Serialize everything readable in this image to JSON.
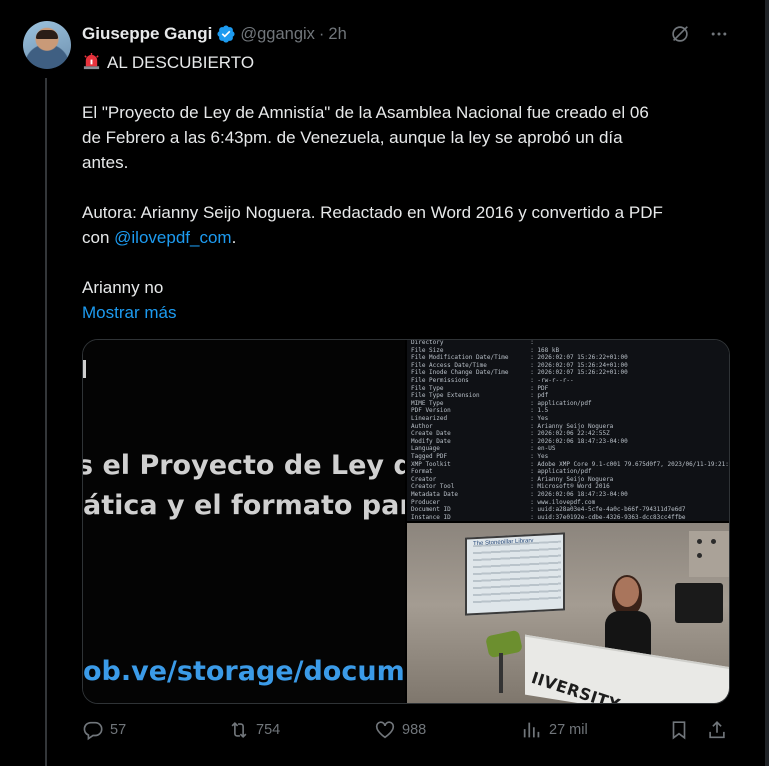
{
  "author": {
    "name": "Giuseppe Gangi",
    "handle": "@ggangix",
    "separator": "·",
    "time": "2h"
  },
  "post": {
    "emoji_icon": "police-siren-icon",
    "heading": "AL DESCUBIERTO",
    "line1": "El \"Proyecto de Ley de Amnistía\" de la Asamblea Nacional fue creado el 06",
    "line2": "de Febrero a las 6:43pm. de Venezuela, aunque la ley se aprobó un día",
    "line3": "antes.",
    "line4": "Autora: Arianny Seijo Noguera. Redactado en Word 2016 y convertido a PDF",
    "line5_prefix": "con ",
    "line5_link": "@ilovepdf_com",
    "line5_suffix": ".",
    "line6": "Arianny no",
    "show_more": "Mostrar más"
  },
  "media": {
    "left_doc": {
      "line1": "s el Proyecto de Ley de A",
      "line2": "ática y el formato para r",
      "url": "ob.ve/storage/docume..."
    },
    "terminal": [
      "Directory                        : ",
      "File Size                        : 168 kB",
      "File Modification Date/Time      : 2026:02:07 15:26:22+01:00",
      "File Access Date/Time            : 2026:02:07 15:26:24+01:00",
      "File Inode Change Date/Time      : 2026:02:07 15:26:22+01:00",
      "File Permissions                 : -rw-r--r--",
      "File Type                        : PDF",
      "File Type Extension              : pdf",
      "MIME Type                        : application/pdf",
      "PDF Version                      : 1.5",
      "Linearized                       : Yes",
      "Author                           : Arianny Seijo Noguera",
      "Create Date                      : 2026:02:06 22:42:55Z",
      "Modify Date                      : 2026:02:06 18:47:23-04:00",
      "Language                         : en-US",
      "Tagged PDF                       : Yes",
      "XMP Toolkit                      : Adobe XMP Core 9.1-c001 79.675d0f7, 2023/06/11-19:21:16",
      "Format                           : application/pdf",
      "Creator                          : Arianny Seijo Noguera",
      "Creator Tool                     : Microsoft® Word 2016",
      "Metadata Date                    : 2026:02:06 18:47:23-04:00",
      "Producer                         : www.ilovepdf.com",
      "Document ID                      : uuid:a28a03e4-5cfe-4a0c-b66f-794311d7e6d7",
      "Instance ID                      : uuid:37e0192e-cdbe-4326-9363-dcc83cc4ffbe"
    ],
    "photo": {
      "sign_text": "IIVERSITY OF WESTMINSTER",
      "screen_title": "The Stonepillar Library"
    }
  },
  "actions": {
    "replies": "57",
    "reposts": "754",
    "likes": "988",
    "views": "27 mil"
  },
  "colors": {
    "background": "#000000",
    "text": "#e7e9ea",
    "muted": "#71767b",
    "link": "#1d9bf0",
    "verified": "#1d9bf0"
  }
}
